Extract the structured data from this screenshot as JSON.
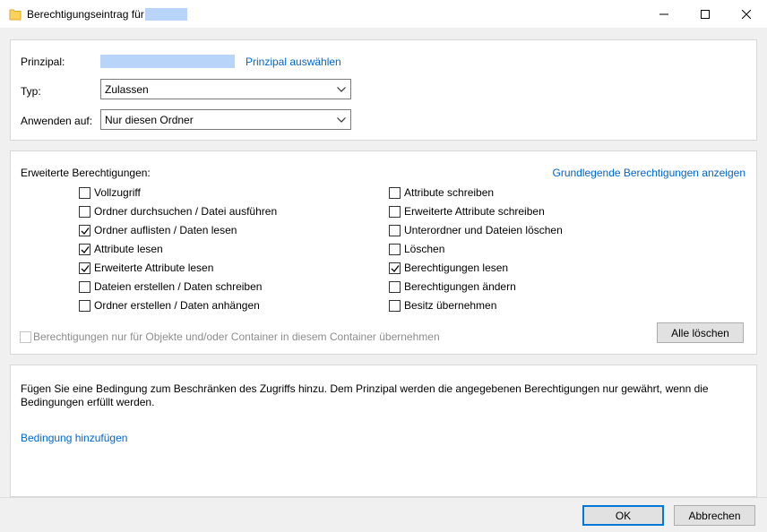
{
  "window": {
    "title": "Berechtigungseintrag für"
  },
  "principal_section": {
    "principal_label": "Prinzipal:",
    "select_principal_link": "Prinzipal auswählen",
    "type_label": "Typ:",
    "type_value": "Zulassen",
    "apply_label": "Anwenden auf:",
    "apply_value": "Nur diesen Ordner"
  },
  "permissions": {
    "heading": "Erweiterte Berechtigungen:",
    "basic_link": "Grundlegende Berechtigungen anzeigen",
    "left": [
      {
        "label": "Vollzugriff",
        "checked": false
      },
      {
        "label": "Ordner durchsuchen / Datei ausführen",
        "checked": false
      },
      {
        "label": "Ordner auflisten / Daten lesen",
        "checked": true
      },
      {
        "label": "Attribute lesen",
        "checked": true
      },
      {
        "label": "Erweiterte Attribute lesen",
        "checked": true
      },
      {
        "label": "Dateien erstellen / Daten schreiben",
        "checked": false
      },
      {
        "label": "Ordner erstellen / Daten anhängen",
        "checked": false
      }
    ],
    "right": [
      {
        "label": "Attribute schreiben",
        "checked": false
      },
      {
        "label": "Erweiterte Attribute schreiben",
        "checked": false
      },
      {
        "label": "Unterordner und Dateien löschen",
        "checked": false
      },
      {
        "label": "Löschen",
        "checked": false
      },
      {
        "label": "Berechtigungen lesen",
        "checked": true
      },
      {
        "label": "Berechtigungen ändern",
        "checked": false
      },
      {
        "label": "Besitz übernehmen",
        "checked": false
      }
    ],
    "inherit_label": "Berechtigungen nur für Objekte und/oder Container in diesem Container übernehmen",
    "clear_all_button": "Alle löschen"
  },
  "conditions": {
    "description": "Fügen Sie eine Bedingung zum Beschränken des Zugriffs hinzu. Dem Prinzipal werden die angegebenen Berechtigungen nur gewährt, wenn die Bedingungen erfüllt werden.",
    "add_condition_link": "Bedingung hinzufügen"
  },
  "footer": {
    "ok_button": "OK",
    "cancel_button": "Abbrechen"
  },
  "colors": {
    "link": "#0066cc",
    "redaction": "#b8d4f8",
    "primary_border": "#0078d7"
  }
}
